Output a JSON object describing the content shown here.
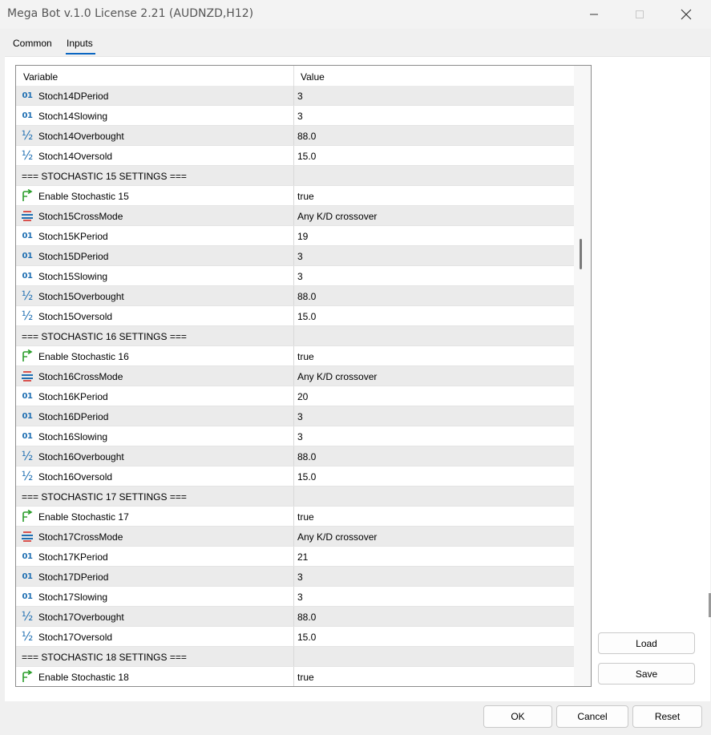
{
  "window": {
    "title": "Mega Bot v.1.0 License 2.21 (AUDNZD,H12)",
    "minimize_icon": "minimize-icon",
    "maximize_icon": "maximize-icon",
    "close_icon": "close-icon"
  },
  "tabs": [
    {
      "label": "Common",
      "active": false
    },
    {
      "label": "Inputs",
      "active": true
    }
  ],
  "grid": {
    "columns": [
      "Variable",
      "Value"
    ],
    "rows": [
      {
        "type": "int",
        "name": "Stoch14DPeriod",
        "value": "3"
      },
      {
        "type": "int",
        "name": "Stoch14Slowing",
        "value": "3"
      },
      {
        "type": "double",
        "name": "Stoch14Overbought",
        "value": "88.0"
      },
      {
        "type": "double",
        "name": "Stoch14Oversold",
        "value": "15.0"
      },
      {
        "type": "section",
        "name": "=== STOCHASTIC 15 SETTINGS ===",
        "value": ""
      },
      {
        "type": "bool",
        "name": "Enable Stochastic 15",
        "value": "true"
      },
      {
        "type": "enum",
        "name": "Stoch15CrossMode",
        "value": "Any K/D crossover"
      },
      {
        "type": "int",
        "name": "Stoch15KPeriod",
        "value": "19"
      },
      {
        "type": "int",
        "name": "Stoch15DPeriod",
        "value": "3"
      },
      {
        "type": "int",
        "name": "Stoch15Slowing",
        "value": "3"
      },
      {
        "type": "double",
        "name": "Stoch15Overbought",
        "value": "88.0"
      },
      {
        "type": "double",
        "name": "Stoch15Oversold",
        "value": "15.0"
      },
      {
        "type": "section",
        "name": "=== STOCHASTIC 16 SETTINGS ===",
        "value": ""
      },
      {
        "type": "bool",
        "name": "Enable Stochastic 16",
        "value": "true"
      },
      {
        "type": "enum",
        "name": "Stoch16CrossMode",
        "value": "Any K/D crossover"
      },
      {
        "type": "int",
        "name": "Stoch16KPeriod",
        "value": "20"
      },
      {
        "type": "int",
        "name": "Stoch16DPeriod",
        "value": "3"
      },
      {
        "type": "int",
        "name": "Stoch16Slowing",
        "value": "3"
      },
      {
        "type": "double",
        "name": "Stoch16Overbought",
        "value": "88.0"
      },
      {
        "type": "double",
        "name": "Stoch16Oversold",
        "value": "15.0"
      },
      {
        "type": "section",
        "name": "=== STOCHASTIC 17 SETTINGS ===",
        "value": ""
      },
      {
        "type": "bool",
        "name": "Enable Stochastic 17",
        "value": "true"
      },
      {
        "type": "enum",
        "name": "Stoch17CrossMode",
        "value": "Any K/D crossover"
      },
      {
        "type": "int",
        "name": "Stoch17KPeriod",
        "value": "21"
      },
      {
        "type": "int",
        "name": "Stoch17DPeriod",
        "value": "3"
      },
      {
        "type": "int",
        "name": "Stoch17Slowing",
        "value": "3"
      },
      {
        "type": "double",
        "name": "Stoch17Overbought",
        "value": "88.0"
      },
      {
        "type": "double",
        "name": "Stoch17Oversold",
        "value": "15.0"
      },
      {
        "type": "section",
        "name": "=== STOCHASTIC 18 SETTINGS ===",
        "value": ""
      },
      {
        "type": "bool",
        "name": "Enable Stochastic 18",
        "value": "true"
      }
    ]
  },
  "side_buttons": {
    "load": "Load",
    "save": "Save"
  },
  "footer_buttons": {
    "ok": "OK",
    "cancel": "Cancel",
    "reset": "Reset"
  },
  "colors": {
    "accent": "#0a66c2",
    "int_icon": "#1f6fb2",
    "bool_icon": "#2a9d2a"
  }
}
